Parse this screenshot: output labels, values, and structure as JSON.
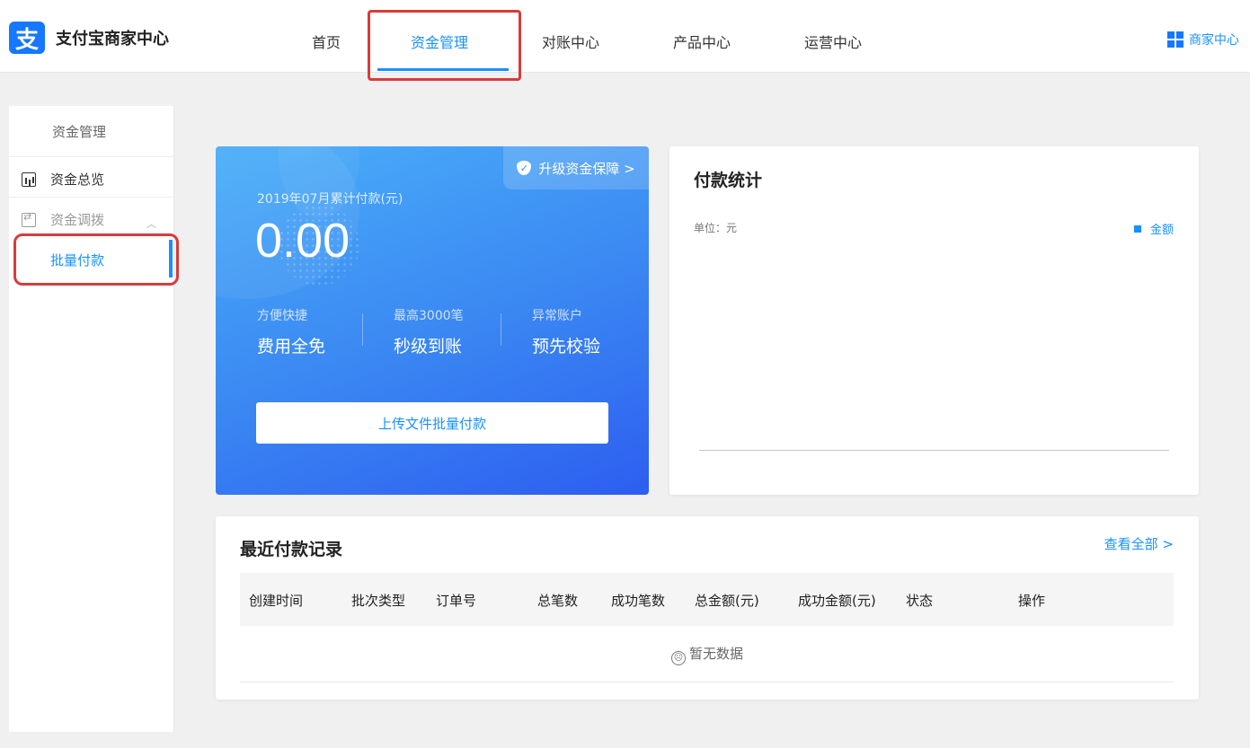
{
  "app": {
    "logo_glyph": "支",
    "title": "支付宝商家中心",
    "brand_color": "#1677ff",
    "accent_color": "#1890ff"
  },
  "nav": {
    "items": [
      "首页",
      "资金管理",
      "对账中心",
      "产品中心",
      "运营中心"
    ],
    "active": "资金管理",
    "merchant_icon": "grid-icon",
    "merchant_label": "商家中心"
  },
  "sidebar": {
    "title": "资金管理",
    "items": [
      {
        "label": "资金总览",
        "icon": "bar-chart-icon"
      },
      {
        "label": "资金调拨",
        "icon": "transfer-icon",
        "expanded": true
      }
    ],
    "sub_items": [
      "批量付款"
    ],
    "active_sub": "批量付款"
  },
  "pay_card": {
    "upgrade_label": "升级资金保障 >",
    "month_label": "2019年07月累计付款(元)",
    "amount": "0.00",
    "features": [
      {
        "small": "方便快捷",
        "big": "费用全免"
      },
      {
        "small": "最高3000笔",
        "big": "秒级到账"
      },
      {
        "small": "异常账户",
        "big": "预先校验"
      }
    ],
    "upload_button": "上传文件批量付款"
  },
  "stats": {
    "title": "付款统计",
    "unit": "单位：元",
    "legend": "金额"
  },
  "chart_data": {
    "type": "bar",
    "categories": [],
    "series": [
      {
        "name": "金额",
        "values": []
      }
    ],
    "title": "付款统计",
    "ylabel": "单位：元"
  },
  "records": {
    "title": "最近付款记录",
    "view_all": "查看全部 >",
    "columns": [
      "创建时间",
      "批次类型",
      "订单号",
      "总笔数",
      "成功笔数",
      "总金额(元)",
      "成功金额(元)",
      "状态",
      "操作"
    ],
    "rows": [],
    "empty_text": "暂无数据"
  }
}
